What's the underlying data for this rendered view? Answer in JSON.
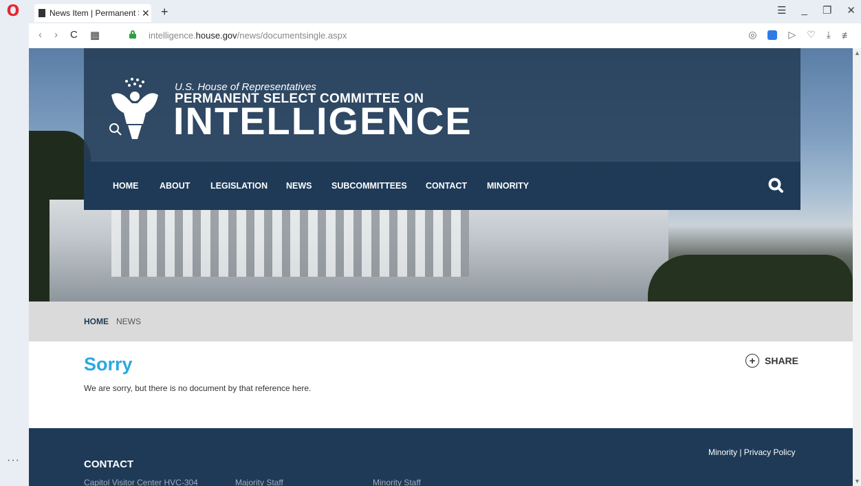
{
  "browser": {
    "tab_title": "News Item | Permanent Sel",
    "url_prefix": "intelligence.",
    "url_host": "house.gov",
    "url_path": "/news/documentsingle.aspx"
  },
  "site": {
    "subtitle": "U.S. House of Representatives",
    "title_line": "PERMANENT SELECT COMMITTEE ON",
    "title_big": "INTELLIGENCE"
  },
  "nav": {
    "items": [
      "HOME",
      "ABOUT",
      "LEGISLATION",
      "NEWS",
      "SUBCOMMITTEES",
      "CONTACT",
      "MINORITY"
    ]
  },
  "breadcrumb": {
    "home": "HOME",
    "current": "NEWS"
  },
  "content": {
    "heading": "Sorry",
    "body": "We are sorry, but there is no document by that reference here.",
    "share_label": "SHARE"
  },
  "footer": {
    "links": "Minority | Privacy Policy",
    "contact_heading": "CONTACT",
    "col1": "Capitol Visitor Center HVC-304",
    "col2": "Majority Staff",
    "col3": "Minority Staff"
  },
  "colors": {
    "brand_navy": "#1e3a57",
    "accent_blue": "#2aa9e0"
  }
}
